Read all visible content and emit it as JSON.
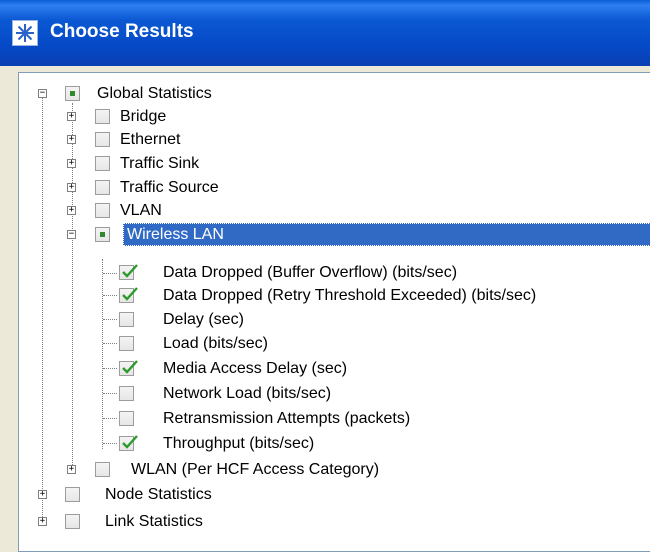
{
  "window": {
    "title": "Choose Results",
    "accent": "#0b58d3"
  },
  "tree": {
    "global": {
      "label": "Global Statistics",
      "expanded": true,
      "state": "partial"
    },
    "global_children": [
      {
        "label": "Bridge",
        "expanded": false,
        "state": "none"
      },
      {
        "label": "Ethernet",
        "expanded": false,
        "state": "none"
      },
      {
        "label": "Traffic Sink",
        "expanded": false,
        "state": "none"
      },
      {
        "label": "Traffic Source",
        "expanded": false,
        "state": "none"
      },
      {
        "label": "VLAN",
        "expanded": false,
        "state": "none"
      },
      {
        "label": "Wireless LAN",
        "expanded": true,
        "state": "partial",
        "selected": true
      },
      {
        "label": "WLAN (Per HCF Access Category)",
        "expanded": false,
        "state": "none"
      }
    ],
    "wireless_children": [
      {
        "label": "Data Dropped (Buffer Overflow) (bits/sec)",
        "checked": true
      },
      {
        "label": "Data Dropped (Retry Threshold Exceeded) (bits/sec)",
        "checked": true
      },
      {
        "label": "Delay (sec)",
        "checked": false
      },
      {
        "label": "Load (bits/sec)",
        "checked": false
      },
      {
        "label": "Media Access Delay (sec)",
        "checked": true
      },
      {
        "label": "Network Load (bits/sec)",
        "checked": false
      },
      {
        "label": "Retransmission Attempts (packets)",
        "checked": false
      },
      {
        "label": "Throughput (bits/sec)",
        "checked": true
      }
    ],
    "root_siblings": [
      {
        "label": "Node Statistics",
        "expanded": false,
        "state": "none"
      },
      {
        "label": "Link Statistics",
        "expanded": false,
        "state": "none"
      }
    ]
  }
}
